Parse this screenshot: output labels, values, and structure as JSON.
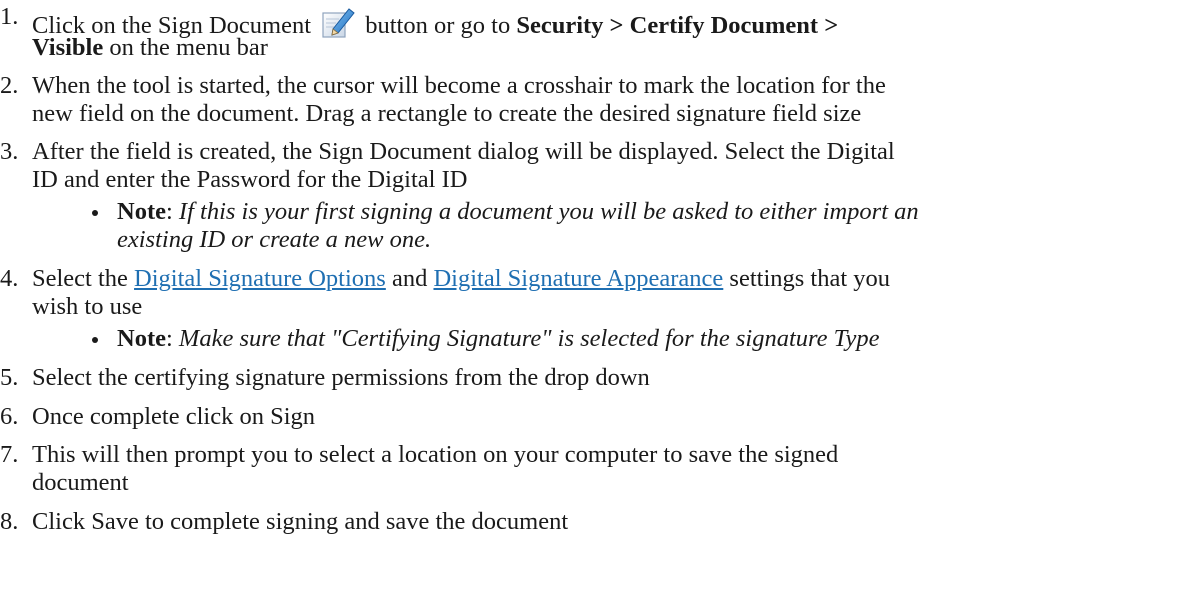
{
  "steps": [
    {
      "number": "1.",
      "line1_a": "Click on the Sign Document",
      "icon": "sign-document-icon",
      "line1_b": "button or go to",
      "line1_bold": "Security > Certify Document >",
      "line2_bold": "Visible",
      "line2_a": "on the menu bar"
    },
    {
      "number": "2.",
      "line1": "When the tool is started, the cursor will become a crosshair to mark the location for the",
      "line2": "new field on the document.  Drag a rectangle to create the desired signature field size"
    },
    {
      "number": "3.",
      "line1": "After the field is created, the Sign Document dialog will be displayed. Select the Digital",
      "line2": "ID and enter the Password for the Digital ID",
      "note_label": "Note",
      "note_colon": ":",
      "note_line1": "If this is your first signing a document you will be asked to either import an",
      "note_line2": "existing ID or create a new one."
    },
    {
      "number": "4.",
      "line1_a": "Select the",
      "link1": "Digital Signature Options",
      "line1_b": "and",
      "link2": "Digital Signature Appearance",
      "line1_c": "settings that you",
      "line2": "wish to use",
      "note_label": "Note",
      "note_colon": ":",
      "note_line1": "Make sure that \"Certifying Signature\" is selected for the signature Type"
    },
    {
      "number": "5.",
      "line1": "Select the certifying signature permissions from the drop down"
    },
    {
      "number": "6.",
      "line1": "Once complete click on Sign"
    },
    {
      "number": "7.",
      "line1": "This will then prompt you to select a location on your computer to save the signed",
      "line2": "document"
    },
    {
      "number": "8.",
      "line1": "Click Save to complete signing and save the document"
    }
  ],
  "colors": {
    "text": "#1a1a1a",
    "link": "#1f6fb2"
  }
}
